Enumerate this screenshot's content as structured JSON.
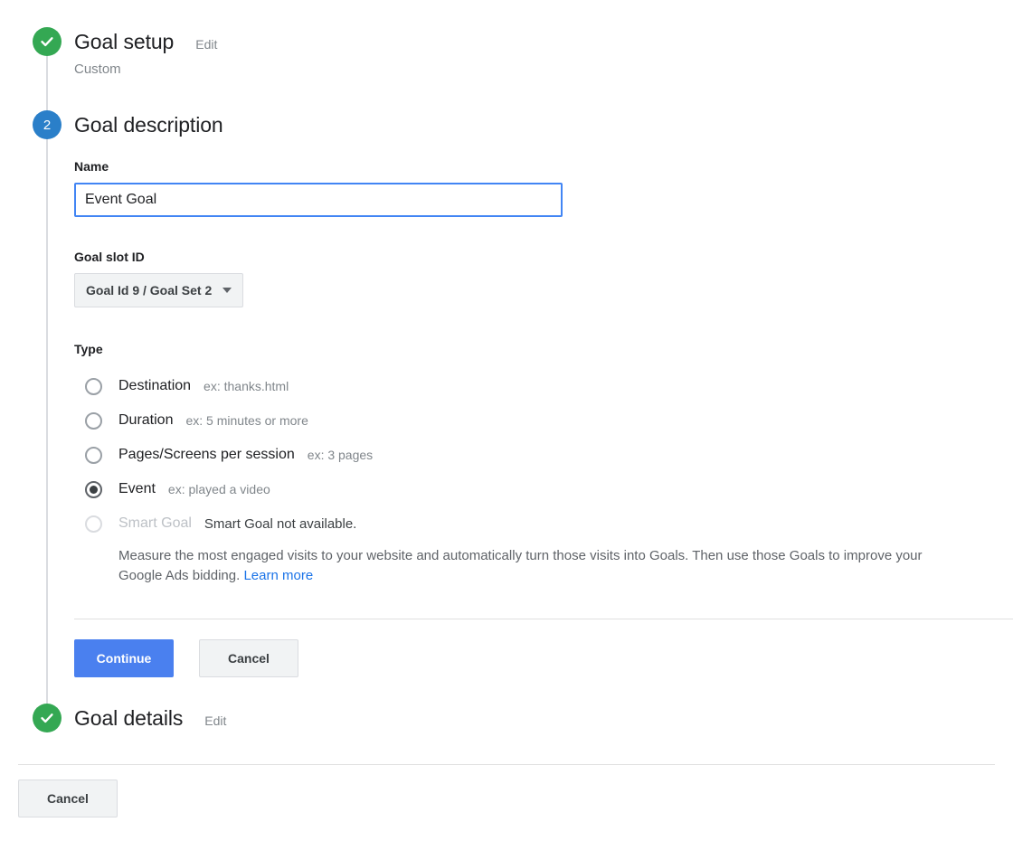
{
  "steps": {
    "goal_setup": {
      "title": "Goal setup",
      "edit_label": "Edit",
      "value": "Custom",
      "marker": "check-icon"
    },
    "goal_description": {
      "title": "Goal description",
      "marker_number": "2"
    },
    "goal_details": {
      "title": "Goal details",
      "edit_label": "Edit",
      "marker": "check-icon"
    }
  },
  "form": {
    "name": {
      "label": "Name",
      "value": "Event Goal",
      "placeholder": ""
    },
    "goal_slot": {
      "label": "Goal slot ID",
      "selected": "Goal Id 9 / Goal Set 2",
      "caret_icon": "chevron-down-icon"
    },
    "type": {
      "label": "Type",
      "options": [
        {
          "label": "Destination",
          "example": "ex: thanks.html",
          "selected": false,
          "disabled": false
        },
        {
          "label": "Duration",
          "example": "ex: 5 minutes or more",
          "selected": false,
          "disabled": false
        },
        {
          "label": "Pages/Screens per session",
          "example": "ex: 3 pages",
          "selected": false,
          "disabled": false
        },
        {
          "label": "Event",
          "example": "ex: played a video",
          "selected": true,
          "disabled": false
        },
        {
          "label": "Smart Goal",
          "example": "Smart Goal not available.",
          "selected": false,
          "disabled": true
        }
      ],
      "smart_goal_description": "Measure the most engaged visits to your website and automatically turn those visits into Goals. Then use those Goals to improve your Google Ads bidding.",
      "learn_more_label": "Learn more"
    }
  },
  "actions": {
    "continue_label": "Continue",
    "cancel_label": "Cancel",
    "footer_cancel_label": "Cancel"
  },
  "colors": {
    "done_green": "#34a853",
    "active_blue": "#2a7fc9",
    "primary_blue": "#4a80ef",
    "link_blue": "#1a73e8",
    "focus_border": "#4285f4"
  }
}
